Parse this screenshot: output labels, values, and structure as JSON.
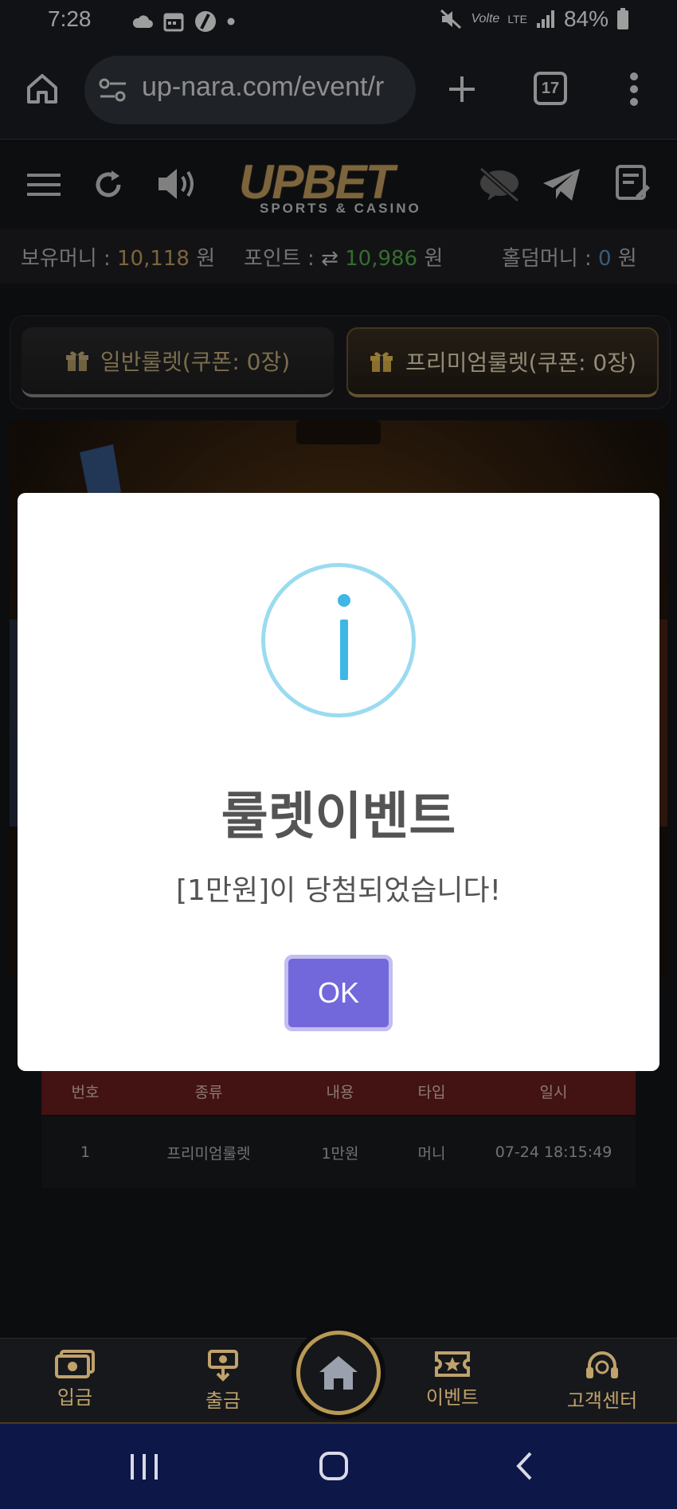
{
  "status_bar": {
    "time": "7:28",
    "battery": "84%",
    "network": "LTE",
    "volte": "Volte"
  },
  "browser": {
    "url": "up-nara.com/event/r",
    "tab_count": "17"
  },
  "site": {
    "logo": "UPBET",
    "logo_sub": "SPORTS & CASINO"
  },
  "money_bar": {
    "held_label": "보유머니 :",
    "held_value": "10,118",
    "point_label": "포인트 :",
    "point_value": "10,986",
    "holdem_label": "홀덤머니 :",
    "holdem_value": "0",
    "unit": "원"
  },
  "tabs": {
    "normal": "일반룰렛(쿠폰: 0장)",
    "premium": "프리미엄룰렛(쿠폰: 0장)"
  },
  "history": {
    "headers": [
      "번호",
      "종류",
      "내용",
      "타입",
      "일시"
    ],
    "rows": [
      [
        "1",
        "프리미엄룰렛",
        "1만원",
        "머니",
        "07-24 18:15:49"
      ]
    ]
  },
  "dialog": {
    "title": "룰렛이벤트",
    "message": "[1만원]이 당첨되었습니다!",
    "ok_label": "OK"
  },
  "bottom_nav": {
    "deposit": "입금",
    "withdraw": "출금",
    "event": "이벤트",
    "support": "고객센터"
  },
  "colors": {
    "accent_gold": "#c8a45e",
    "point_green": "#56b14b",
    "ok_button": "#7367dc",
    "info_blue": "#3fb7e6",
    "table_header": "#6b1f1d"
  }
}
